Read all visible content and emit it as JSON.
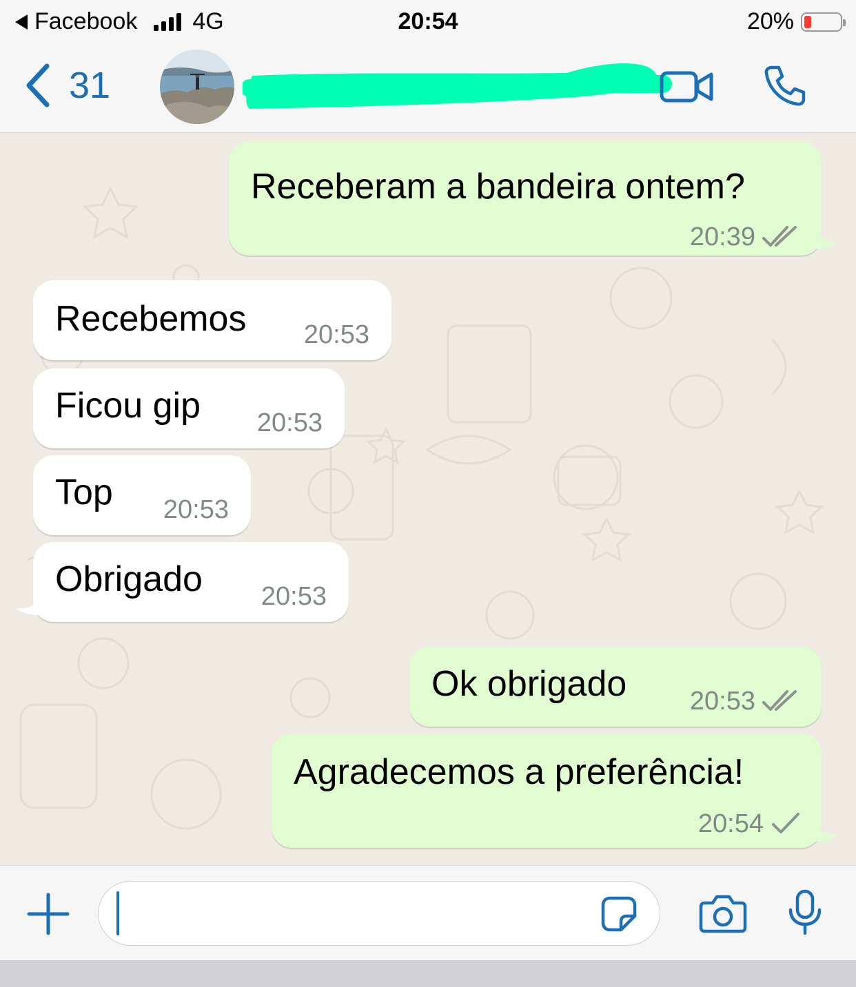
{
  "status_bar": {
    "back_app": "Facebook",
    "network": "4G",
    "time": "20:54",
    "battery": "20%",
    "battery_level": 0.2
  },
  "header": {
    "back_count": "31",
    "contact_name_redacted": true,
    "icons": [
      "chevron-left-icon",
      "video-camera-icon",
      "phone-icon"
    ]
  },
  "messages": [
    {
      "direction": "out",
      "text": "Receberam a bandeira ontem?",
      "time": "20:39",
      "status": "read"
    },
    {
      "direction": "in",
      "text": "Recebemos",
      "time": "20:53"
    },
    {
      "direction": "in",
      "text": "Ficou gip",
      "time": "20:53"
    },
    {
      "direction": "in",
      "text": "Top",
      "time": "20:53"
    },
    {
      "direction": "in",
      "text": "Obrigado",
      "time": "20:53"
    },
    {
      "direction": "out",
      "text": "Ok obrigado",
      "time": "20:53",
      "status": "read"
    },
    {
      "direction": "out",
      "text": "Agradecemos a preferência!",
      "time": "20:54",
      "status": "sent"
    }
  ],
  "input_bar": {
    "placeholder": "",
    "icons": [
      "plus-icon",
      "sticker-icon",
      "camera-icon",
      "microphone-icon"
    ]
  },
  "colors": {
    "accent": "#1a6fb8",
    "outgoing_bubble": "#e1fcd1",
    "incoming_bubble": "#ffffff",
    "chat_background": "#efeae2",
    "redaction": "#00ffb3"
  }
}
